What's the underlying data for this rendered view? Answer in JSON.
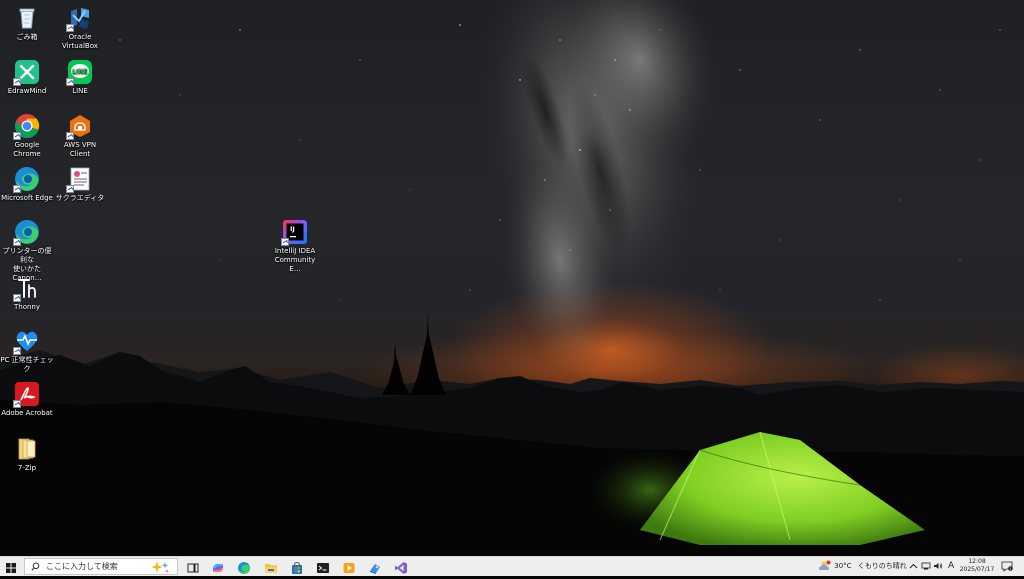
{
  "desktop": {
    "icons": [
      {
        "label": "ごみ箱",
        "icon": "recycle-bin-icon"
      },
      {
        "label": "Oracle VirtualBox",
        "icon": "virtualbox-icon"
      },
      {
        "label": "EdrawMind",
        "icon": "edrawmind-icon"
      },
      {
        "label": "LINE",
        "icon": "line-icon"
      },
      {
        "label": "Google Chrome",
        "icon": "chrome-icon"
      },
      {
        "label": "AWS VPN Client",
        "icon": "aws-vpn-icon"
      },
      {
        "label": "Microsoft Edge",
        "icon": "edge-icon"
      },
      {
        "label": "サクラエディタ",
        "icon": "sakura-editor-icon"
      },
      {
        "label": "プリンターの便利な\n使いかた Canon…",
        "icon": "canon-printer-guide-icon"
      },
      {
        "label": "IntelliJ IDEA\nCommunity E…",
        "icon": "intellij-icon"
      },
      {
        "label": "Thonny",
        "icon": "thonny-icon"
      },
      {
        "label": "PC 正常性チェック",
        "icon": "pc-health-check-icon"
      },
      {
        "label": "Adobe Acrobat",
        "icon": "acrobat-icon"
      },
      {
        "label": "7-Zip",
        "icon": "7zip-folder-icon"
      }
    ]
  },
  "taskbar": {
    "search_placeholder": "ここに入力して検索",
    "apps": [
      "task-view-icon",
      "copilot-icon",
      "edge-icon",
      "file-explorer-icon",
      "microsoft-store-icon",
      "terminal-icon",
      "media-player-icon",
      "network-app-icon",
      "visual-studio-icon"
    ],
    "weather": {
      "temp": "30°C",
      "desc": "くもりのち晴れ"
    },
    "ime": "A",
    "time": "12:08",
    "date": "2025/07/17",
    "notification_count": "1"
  },
  "colors": {
    "taskbar_bg": "#eeeeee",
    "tent_green": "#8fdc2c",
    "horizon_glow": "#e0692a"
  }
}
